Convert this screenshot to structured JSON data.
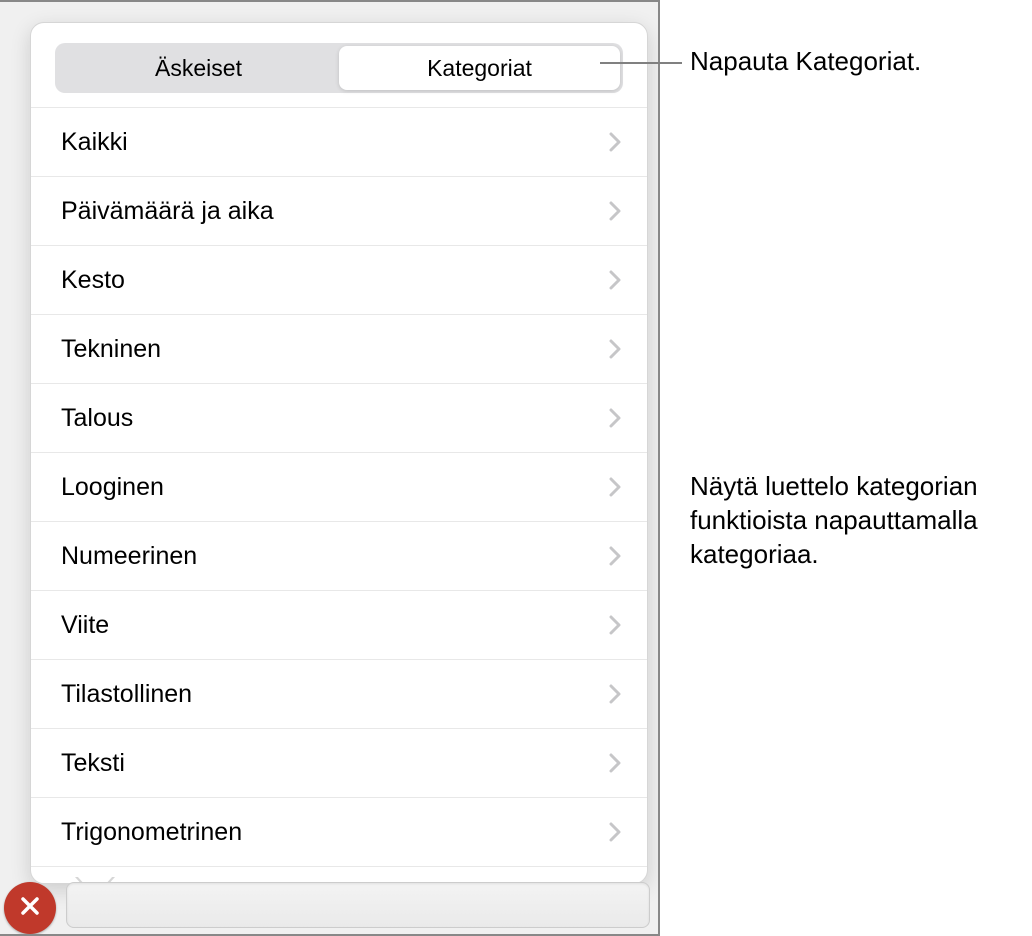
{
  "segmented": {
    "recent_label": "Äskeiset",
    "categories_label": "Kategoriat",
    "active": "categories"
  },
  "categories": [
    {
      "label": "Kaikki"
    },
    {
      "label": "Päivämäärä ja aika"
    },
    {
      "label": "Kesto"
    },
    {
      "label": "Tekninen"
    },
    {
      "label": "Talous"
    },
    {
      "label": "Looginen"
    },
    {
      "label": "Numeerinen"
    },
    {
      "label": "Viite"
    },
    {
      "label": "Tilastollinen"
    },
    {
      "label": "Teksti"
    },
    {
      "label": "Trigonometrinen"
    }
  ],
  "callouts": {
    "tap_categories": "Napauta Kategoriat.",
    "tap_category_list": "Näytä luettelo kategorian funktioista napauttamalla kategoriaa."
  }
}
